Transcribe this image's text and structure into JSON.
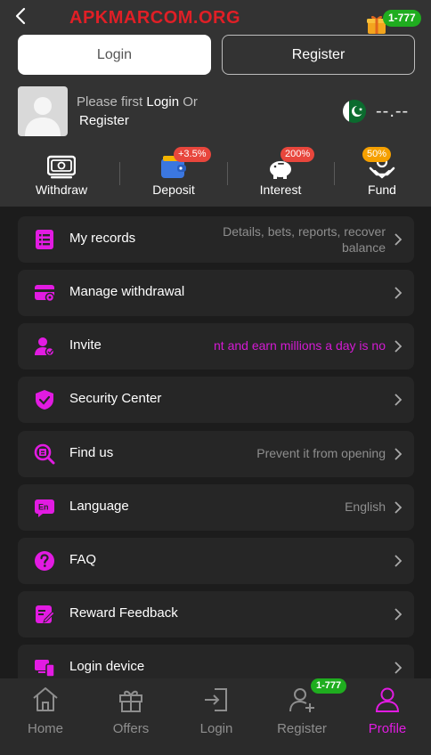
{
  "watermark": "APKMARCOM.ORG",
  "gift_badge": "1-777",
  "auth": {
    "login_label": "Login",
    "register_label": "Register"
  },
  "user": {
    "prompt_prefix": "Please first ",
    "login_link": "Login",
    "prompt_or": " Or",
    "register_link": "Register",
    "balance": "--.--"
  },
  "quick_actions": [
    {
      "label": "Withdraw",
      "icon": "wallet-cash-icon",
      "badge": ""
    },
    {
      "label": "Deposit",
      "icon": "wallet-icon",
      "badge": "+3.5%"
    },
    {
      "label": "Interest",
      "icon": "piggy-bank-icon",
      "badge": "200%"
    },
    {
      "label": "Fund",
      "icon": "hand-coin-icon",
      "badge": "50%"
    }
  ],
  "menu": [
    {
      "label": "My records",
      "sub": [
        "Details, bets, reports, recover",
        "balance"
      ],
      "icon": "records-icon"
    },
    {
      "label": "Manage withdrawal",
      "sub": [],
      "icon": "card-icon"
    },
    {
      "label": "Invite",
      "sub": [
        "nt and earn millions a day is no"
      ],
      "icon": "invite-user-icon"
    },
    {
      "label": "Security Center",
      "sub": [],
      "icon": "shield-check-icon"
    },
    {
      "label": "Find us",
      "sub": [
        "Prevent it from opening"
      ],
      "icon": "find-icon"
    },
    {
      "label": "Language",
      "sub": [
        "English"
      ],
      "icon": "language-icon"
    },
    {
      "label": "FAQ",
      "sub": [],
      "icon": "question-icon"
    },
    {
      "label": "Reward Feedback",
      "sub": [],
      "icon": "feedback-icon"
    },
    {
      "label": "Login device",
      "sub": [],
      "icon": "device-icon"
    }
  ],
  "bottom_nav": [
    {
      "label": "Home",
      "icon": "home-icon"
    },
    {
      "label": "Offers",
      "icon": "gift-icon"
    },
    {
      "label": "Login",
      "icon": "login-door-icon"
    },
    {
      "label": "Register",
      "icon": "add-user-icon"
    },
    {
      "label": "Profile",
      "icon": "profile-icon",
      "active": true
    }
  ],
  "nav_badge": "1-777",
  "colors": {
    "accent": "#e21be2",
    "badge_green": "#1fad1f",
    "badge_red": "#e8463c",
    "badge_orange": "#f5a000"
  }
}
